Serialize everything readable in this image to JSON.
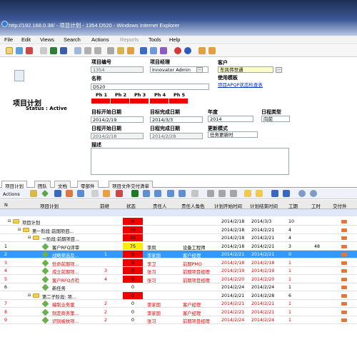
{
  "window": {
    "title": "http://192.168.0.38/ - 项目计划 - 1354 D520 - Windows Internet Explorer"
  },
  "menu": [
    "File",
    "Edit",
    "Views",
    "Search",
    "Actions",
    "Reports",
    "Tools",
    "Help"
  ],
  "form": {
    "title": "项目计划",
    "status": "Status : Active",
    "project_no_label": "项目编号",
    "project_no": "1354",
    "pm_label": "项目经理",
    "pm": "Innovator Admin",
    "customer_label": "客户",
    "customer": "东风伟世通",
    "name_label": "名称",
    "name": "D520",
    "template_label": "使用模板",
    "template": "项目APQP状态检查表",
    "phases": [
      "Ph 1",
      "Ph 2",
      "Ph 3",
      "Ph 4",
      "Ph 5"
    ],
    "target_start_label": "目标开始日期",
    "target_start": "2014/2/19",
    "target_end_label": "目标完成日期",
    "target_end": "2014/3/3",
    "year_label": "年度",
    "year": "2014",
    "cal_type_label": "日程类型",
    "cal_type": "向前",
    "sched_start_label": "日程开始日期",
    "sched_start": "2014/2/18",
    "sched_end_label": "日程完成日期",
    "sched_end": "2014/2/28",
    "update_mode_label": "更新模式",
    "update_mode": "任务更新时",
    "desc_label": "描述"
  },
  "tabs": [
    "项目计划",
    "团队",
    "文档",
    "零部件",
    "项目文件交付清单"
  ],
  "actions_label": "Actions",
  "columns": [
    "N",
    "项目计划",
    "前继",
    "状态",
    "责任人",
    "责任人角色",
    "计划开始时间",
    "计划结束时间",
    "工期",
    "工时",
    "交付件"
  ],
  "rows": [
    {
      "n": "",
      "name": "项目计划",
      "pre": "",
      "status": "6",
      "owner": "",
      "role": "",
      "start": "2014/2/18",
      "end": "2014/3/3",
      "dur": "10",
      "hours": "",
      "type": "folder",
      "indent": 0,
      "red": false,
      "status_color": "#ee0000"
    },
    {
      "n": "",
      "name": "第一阶段:前期项目...",
      "pre": "",
      "status": "16",
      "owner": "",
      "role": "",
      "start": "2014/2/18",
      "end": "2014/2/21",
      "dur": "4",
      "hours": "",
      "type": "folder",
      "indent": 1,
      "red": false,
      "status_color": "#ee0000"
    },
    {
      "n": "",
      "name": "一阶段:前期项目...",
      "pre": "",
      "status": "45",
      "owner": "",
      "role": "",
      "start": "2014/2/18",
      "end": "2014/2/21",
      "dur": "4",
      "hours": "",
      "type": "folder",
      "indent": 2,
      "red": false,
      "status_color": "#ee0000"
    },
    {
      "n": "1",
      "name": "客户RFQ评审",
      "pre": "",
      "status": "75",
      "owner": "李凤",
      "role": "设备工程师",
      "start": "2014/2/18",
      "end": "2014/2/21",
      "dur": "3",
      "hours": "48",
      "type": "task",
      "indent": 3,
      "red": false,
      "status_color": "#ffee00"
    },
    {
      "n": "2",
      "name": "战略筛选及...",
      "pre": "1",
      "status": "0",
      "owner": "李家国",
      "role": "客户经理",
      "start": "2014/2/21",
      "end": "2014/2/21",
      "dur": "0",
      "hours": "",
      "type": "task",
      "indent": 3,
      "red": false,
      "status_color": "#ee0000",
      "selected": true
    },
    {
      "n": "3",
      "name": "任命前期项...",
      "pre": "",
      "status": "0",
      "owner": "李卫",
      "role": "前期PMO",
      "start": "2014/2/18",
      "end": "2014/2/18",
      "dur": "1",
      "hours": "",
      "type": "task",
      "indent": 3,
      "red": true,
      "status_color": "#ee0000"
    },
    {
      "n": "4",
      "name": "成立前期项...",
      "pre": "3",
      "status": "0",
      "owner": "张习",
      "role": "前期项目经理",
      "start": "2014/2/19",
      "end": "2014/2/19",
      "dur": "1",
      "hours": "",
      "type": "task",
      "indent": 3,
      "red": true,
      "status_color": "#ee0000"
    },
    {
      "n": "5",
      "name": "客户RFQ点检",
      "pre": "4",
      "status": "0",
      "owner": "张习",
      "role": "前期项目经理",
      "start": "2014/2/20",
      "end": "2014/2/20",
      "dur": "1",
      "hours": "",
      "type": "task",
      "indent": 3,
      "red": true,
      "status_color": "#ee0000"
    },
    {
      "n": "6",
      "name": "新任务",
      "pre": "",
      "status": "0",
      "owner": "",
      "role": "",
      "start": "2014/2/24",
      "end": "2014/2/24",
      "dur": "1",
      "hours": "",
      "type": "task",
      "indent": 3,
      "red": false,
      "status_color": "#ffffff"
    },
    {
      "n": "",
      "name": "第二子阶段: 项...",
      "pre": "",
      "status": "0",
      "owner": "",
      "role": "",
      "start": "2014/2/21",
      "end": "2014/2/28",
      "dur": "6",
      "hours": "",
      "type": "folder",
      "indent": 2,
      "red": false,
      "status_color": "#ee0000"
    },
    {
      "n": "7",
      "name": "编制业务案",
      "pre": "2",
      "status": "0",
      "owner": "李家国",
      "role": "客户经理",
      "start": "2014/2/21",
      "end": "2014/2/21",
      "dur": "1",
      "hours": "",
      "type": "task",
      "indent": 3,
      "red": true,
      "status_color": "#ffffff"
    },
    {
      "n": "8",
      "name": "制定商务策...",
      "pre": "2",
      "status": "0",
      "owner": "李家国",
      "role": "客户经理",
      "start": "2014/2/21",
      "end": "2014/2/21",
      "dur": "1",
      "hours": "",
      "type": "task",
      "indent": 3,
      "red": true,
      "status_color": "#ffffff"
    },
    {
      "n": "9",
      "name": "识别被扶项...",
      "pre": "2",
      "status": "0",
      "owner": "张习",
      "role": "前期项目经理",
      "start": "2014/2/24",
      "end": "2014/2/24",
      "dur": "1",
      "hours": "",
      "type": "task",
      "indent": 3,
      "red": true,
      "status_color": "#ffffff"
    }
  ]
}
